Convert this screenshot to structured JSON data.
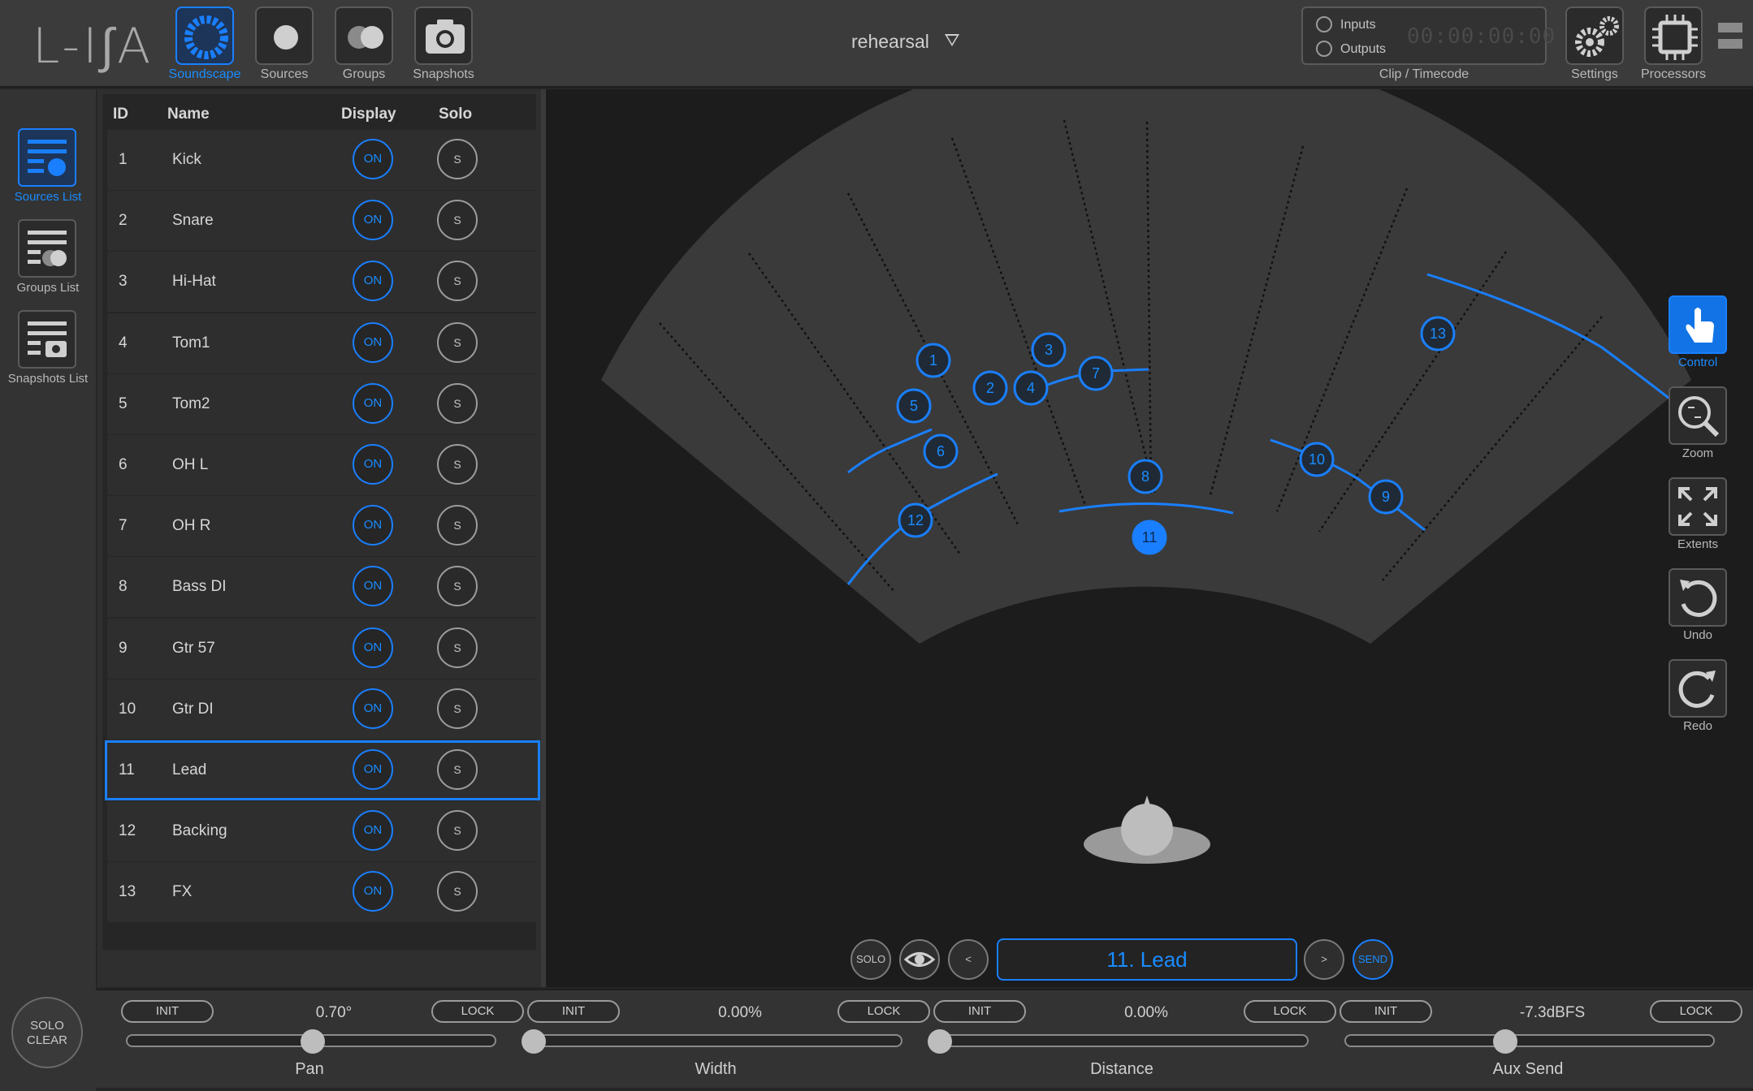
{
  "app": {
    "logo": "L-I∫A"
  },
  "topnav": {
    "items": [
      {
        "label": "Soundscape",
        "icon": "soundscape-icon",
        "active": true
      },
      {
        "label": "Sources",
        "icon": "sources-icon"
      },
      {
        "label": "Groups",
        "icon": "groups-icon"
      },
      {
        "label": "Snapshots",
        "icon": "camera-icon"
      }
    ],
    "preset": "rehearsal",
    "clip": {
      "inputs": "Inputs",
      "outputs": "Outputs",
      "timecode": "00:00:00:00",
      "label": "Clip / Timecode"
    },
    "settings": "Settings",
    "processors": "Processors"
  },
  "leftnav": {
    "items": [
      {
        "label": "Sources List",
        "active": true
      },
      {
        "label": "Groups List"
      },
      {
        "label": "Snapshots List"
      }
    ],
    "solo_clear_1": "SOLO",
    "solo_clear_2": "CLEAR"
  },
  "sources_list": {
    "headers": {
      "id": "ID",
      "name": "Name",
      "display": "Display",
      "solo": "Solo"
    },
    "on_label": "ON",
    "solo_label": "S",
    "rows": [
      {
        "id": "1",
        "name": "Kick"
      },
      {
        "id": "2",
        "name": "Snare"
      },
      {
        "id": "3",
        "name": "Hi-Hat"
      },
      {
        "id": "4",
        "name": "Tom1"
      },
      {
        "id": "5",
        "name": "Tom2"
      },
      {
        "id": "6",
        "name": "OH L"
      },
      {
        "id": "7",
        "name": "OH R"
      },
      {
        "id": "8",
        "name": "Bass DI"
      },
      {
        "id": "9",
        "name": "Gtr 57"
      },
      {
        "id": "10",
        "name": "Gtr DI"
      },
      {
        "id": "11",
        "name": "Lead",
        "selected": true
      },
      {
        "id": "12",
        "name": "Backing"
      },
      {
        "id": "13",
        "name": "FX"
      }
    ]
  },
  "soundscape": {
    "source_markers": [
      "1",
      "2",
      "3",
      "4",
      "5",
      "6",
      "7",
      "8",
      "9",
      "10",
      "11",
      "12",
      "13"
    ],
    "selected_source": "11"
  },
  "right_tools": [
    {
      "label": "Control",
      "icon": "hand-pointer-icon",
      "active": true
    },
    {
      "label": "Zoom",
      "icon": "zoom-icon"
    },
    {
      "label": "Extents",
      "icon": "extents-icon"
    },
    {
      "label": "Undo",
      "icon": "undo-icon"
    },
    {
      "label": "Redo",
      "icon": "redo-icon"
    }
  ],
  "source_nav": {
    "solo": "SOLO",
    "prev": "<",
    "next": ">",
    "send": "SEND",
    "selected_label": "11. Lead"
  },
  "params": [
    {
      "label": "Pan",
      "value": "0.70°",
      "init": "INIT",
      "lock": "LOCK",
      "level": 0.5
    },
    {
      "label": "Width",
      "value": "0.00%",
      "init": "INIT",
      "lock": "LOCK",
      "level": 0.0
    },
    {
      "label": "Distance",
      "value": "0.00%",
      "init": "INIT",
      "lock": "LOCK",
      "level": 0.0
    },
    {
      "label": "Aux Send",
      "value": "-7.3dBFS",
      "init": "INIT",
      "lock": "LOCK",
      "level": 0.43
    }
  ],
  "colors": {
    "accent": "#1a8cff",
    "background": "#1c1c1c",
    "panel": "#3b3b3b"
  }
}
